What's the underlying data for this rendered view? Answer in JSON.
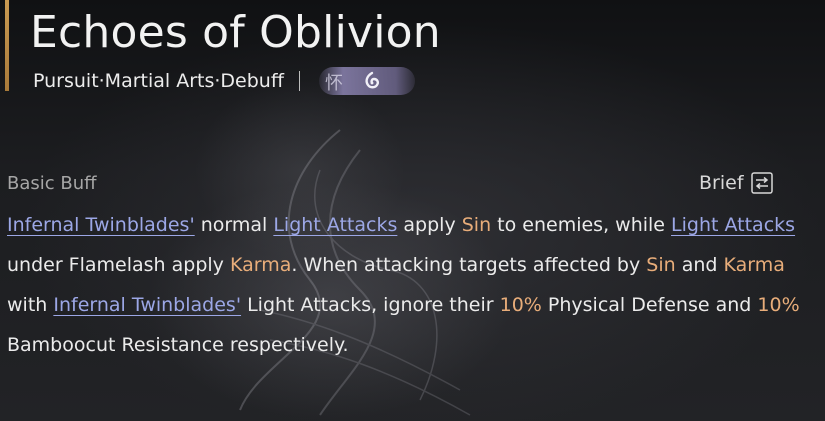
{
  "skill": {
    "title": "Echoes of Oblivion",
    "tags": "Pursuit·Martial Arts·Debuff",
    "faction_glyph": "怀",
    "faction_icon": "flame-swirl-icon"
  },
  "section": {
    "label": "Basic Buff",
    "brief_label": "Brief",
    "brief_icon": "swap-arrows-icon"
  },
  "description": {
    "s1": "Infernal Twinblades'",
    "s2": " normal ",
    "s3": "Light Attacks",
    "s4": " apply ",
    "s5": "Sin",
    "s6": " to enemies, while ",
    "s7": "Light Attacks",
    "s8": " under Flamelash apply ",
    "s9": "Karma",
    "s10": ". When attacking targets affected by ",
    "s11": "Sin",
    "s12": " and ",
    "s13": "Karma",
    "s14": " with ",
    "s15": "Infernal Twinblades'",
    "s16": " Light Attacks, ignore their ",
    "s17": "10%",
    "s18": " Physical Defense and ",
    "s19": "10%",
    "s20": " Bamboocut Resistance respectively."
  },
  "colors": {
    "accent_bar": "#c99a52",
    "link": "#9ca7e6",
    "highlight": "#e8ad7a",
    "text": "#ebebeb",
    "muted": "#a6a6a6"
  }
}
